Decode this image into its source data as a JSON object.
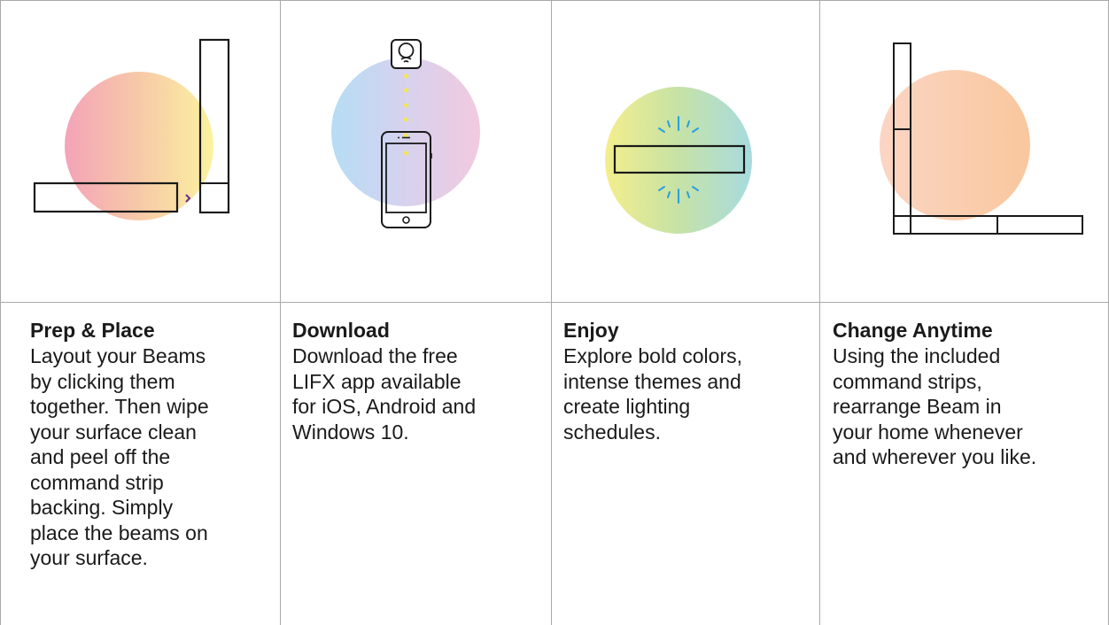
{
  "steps": [
    {
      "title": "Prep & Place",
      "lines": [
        "Layout your Beams",
        "by clicking them",
        "together. Then wipe",
        "your surface clean",
        "and peel off the",
        "command strip",
        "backing. Simply",
        "place the beams on",
        "your surface."
      ]
    },
    {
      "title": "Download",
      "lines": [
        "Download the free",
        "LIFX app available",
        "for iOS, Android and",
        "Windows 10."
      ]
    },
    {
      "title": "Enjoy",
      "lines": [
        "Explore bold colors,",
        "intense themes and",
        "create lighting",
        "schedules."
      ]
    },
    {
      "title": "Change Anytime",
      "lines": [
        "Using the included",
        "command strips,",
        "rearrange Beam in",
        "your home whenever",
        "and wherever you like."
      ]
    }
  ],
  "illustrations": [
    {
      "name": "beams-click-together",
      "icons": [
        "arrow-right-icon"
      ],
      "colors": [
        "#f4a3b8",
        "#f7c9a8",
        "#fbf2a0"
      ]
    },
    {
      "name": "phone-download",
      "icons": [
        "hub-icon",
        "smartphone-icon"
      ],
      "colors": [
        "#b5ddf5",
        "#d7d2ee",
        "#f2c9df"
      ]
    },
    {
      "name": "beam-glow",
      "icons": [
        "glow-rays-icon"
      ],
      "colors": [
        "#f4ee8c",
        "#c6e2a6",
        "#a7dbe0"
      ]
    },
    {
      "name": "rearranged-beams",
      "icons": [],
      "colors": [
        "#fbd5c4",
        "#f9c79d"
      ]
    }
  ],
  "accent_colors": {
    "dots": "#f5e84a",
    "rays": "#2a9fe0",
    "arrow": "#6a2c8f",
    "outline": "#1a1a1a",
    "border": "#a9a9a9"
  }
}
